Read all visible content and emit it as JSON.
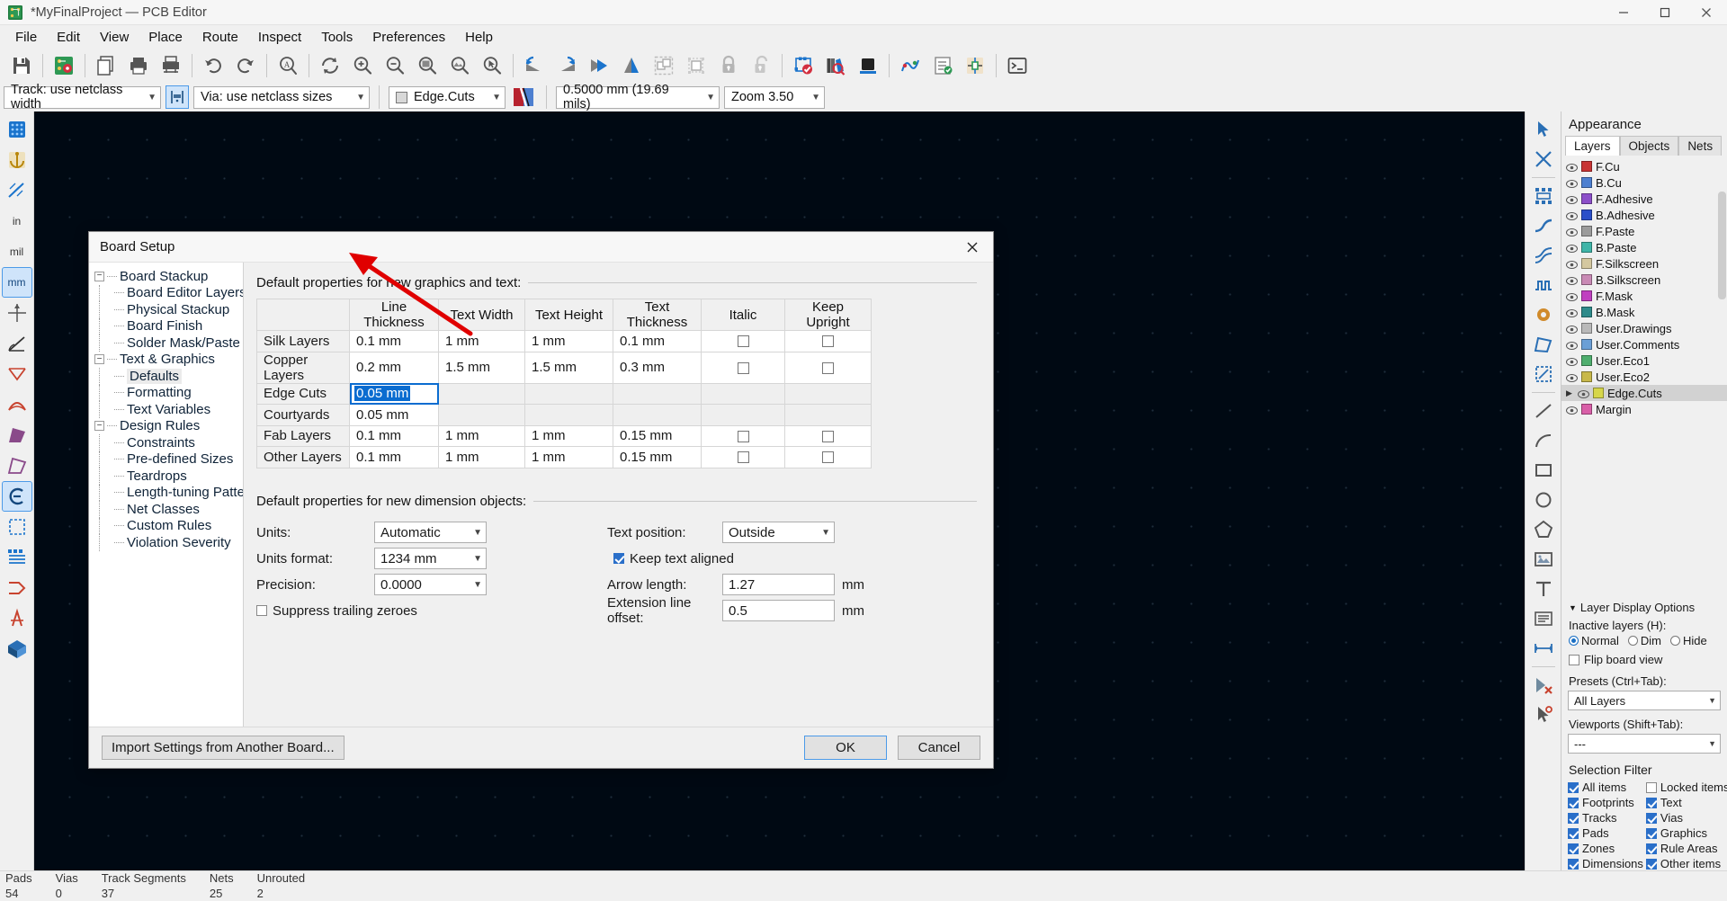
{
  "window": {
    "title": "*MyFinalProject — PCB Editor",
    "icon": "kicad-pcb-icon",
    "minimize": "—",
    "maximize": "▢",
    "close": "✕"
  },
  "menu": {
    "items": [
      "File",
      "Edit",
      "View",
      "Place",
      "Route",
      "Inspect",
      "Tools",
      "Preferences",
      "Help"
    ]
  },
  "toolbar_main": {
    "buttons": [
      {
        "name": "save-icon",
        "tip": "Save"
      },
      {
        "name": "board-setup-icon",
        "tip": "Board Setup"
      },
      {
        "name": "page-settings-icon",
        "tip": "Page Settings"
      },
      {
        "name": "print-icon",
        "tip": "Print"
      },
      {
        "name": "plot-icon",
        "tip": "Plot"
      },
      {
        "name": "undo-icon",
        "tip": "Undo"
      },
      {
        "name": "redo-icon",
        "tip": "Redo"
      },
      {
        "name": "find-icon",
        "tip": "Find"
      },
      {
        "name": "refresh-icon",
        "tip": "Refresh"
      },
      {
        "name": "zoom-in-icon",
        "tip": "Zoom In"
      },
      {
        "name": "zoom-out-icon",
        "tip": "Zoom Out"
      },
      {
        "name": "zoom-fit-page-icon",
        "tip": "Zoom to Fit Page"
      },
      {
        "name": "zoom-fit-objects-icon",
        "tip": "Zoom to Objects"
      },
      {
        "name": "zoom-selection-icon",
        "tip": "Zoom to Selection"
      },
      {
        "name": "rotate-ccw-icon",
        "tip": "Rotate Counterclockwise"
      },
      {
        "name": "rotate-cw-icon",
        "tip": "Rotate Clockwise"
      },
      {
        "name": "flip-horizontal-icon",
        "tip": "Mirror Horizontally"
      },
      {
        "name": "flip-vertical-icon",
        "tip": "Mirror Vertically"
      },
      {
        "name": "group-icon",
        "tip": "Group Items"
      },
      {
        "name": "ungroup-icon",
        "tip": "Ungroup Items"
      },
      {
        "name": "lock-icon",
        "tip": "Lock"
      },
      {
        "name": "unlock-icon",
        "tip": "Unlock"
      },
      {
        "name": "drc-icon",
        "tip": "Design Rules Checker"
      },
      {
        "name": "footprint-library-icon",
        "tip": "Footprint Library Browser"
      },
      {
        "name": "view-3d-icon",
        "tip": "3D Viewer"
      },
      {
        "name": "net-inspector-icon",
        "tip": "Net Inspector"
      },
      {
        "name": "checklist-icon",
        "tip": "Footprint Checker"
      },
      {
        "name": "schematic-icon",
        "tip": "Show Schematic Editor"
      },
      {
        "name": "scripting-console-icon",
        "tip": "Scripting Console"
      }
    ]
  },
  "toolbar_options": {
    "track_width": "Track: use netclass width",
    "netclass_toggle_icon": "auto-track-width-icon",
    "via_size": "Via: use netclass sizes",
    "active_layer": "Edge.Cuts",
    "layer_pair_icon": "layer-pair-icon",
    "grid_size": "0.5000 mm (19.69 mils)",
    "zoom_level": "Zoom 3.50"
  },
  "appearance": {
    "title": "Appearance",
    "tabs": [
      "Layers",
      "Objects",
      "Nets"
    ],
    "active_tab": "Layers",
    "layers": [
      {
        "name": "F.Cu",
        "color": "#c83434"
      },
      {
        "name": "B.Cu",
        "color": "#4d7fd0"
      },
      {
        "name": "F.Adhesive",
        "color": "#8c4fc9"
      },
      {
        "name": "B.Adhesive",
        "color": "#2b4fc9"
      },
      {
        "name": "F.Paste",
        "color": "#9b9b9b"
      },
      {
        "name": "B.Paste",
        "color": "#3fb5a8"
      },
      {
        "name": "F.Silkscreen",
        "color": "#d4c8a0"
      },
      {
        "name": "B.Silkscreen",
        "color": "#c98ab5"
      },
      {
        "name": "F.Mask",
        "color": "#c040c0"
      },
      {
        "name": "B.Mask",
        "color": "#2e8b8b"
      },
      {
        "name": "User.Drawings",
        "color": "#b9b9b9"
      },
      {
        "name": "User.Comments",
        "color": "#6b9fd6"
      },
      {
        "name": "User.Eco1",
        "color": "#4fae6e"
      },
      {
        "name": "User.Eco2",
        "color": "#c8b84a"
      },
      {
        "name": "Edge.Cuts",
        "color": "#d6d64a",
        "selected": true
      },
      {
        "name": "Margin",
        "color": "#d95fa8"
      }
    ],
    "layer_display_options": {
      "header": "Layer Display Options",
      "inactive_label": "Inactive layers (H):",
      "modes": [
        "Normal",
        "Dim",
        "Hide"
      ],
      "selected_mode": "Normal",
      "flip_board_view": "Flip board view",
      "flip_board_checked": false
    },
    "presets": {
      "label": "Presets (Ctrl+Tab):",
      "value": "All Layers"
    },
    "viewports": {
      "label": "Viewports (Shift+Tab):",
      "value": "---"
    },
    "selection_filter": {
      "title": "Selection Filter",
      "items": [
        {
          "label": "All items",
          "checked": true
        },
        {
          "label": "Locked items",
          "checked": false
        },
        {
          "label": "Footprints",
          "checked": true
        },
        {
          "label": "Text",
          "checked": true
        },
        {
          "label": "Tracks",
          "checked": true
        },
        {
          "label": "Vias",
          "checked": true
        },
        {
          "label": "Pads",
          "checked": true
        },
        {
          "label": "Graphics",
          "checked": true
        },
        {
          "label": "Zones",
          "checked": true
        },
        {
          "label": "Rule Areas",
          "checked": true
        },
        {
          "label": "Dimensions",
          "checked": true
        },
        {
          "label": "Other items",
          "checked": true
        }
      ]
    }
  },
  "left_tools": [
    {
      "name": "grid-origin-icon"
    },
    {
      "name": "anchor-icon"
    },
    {
      "name": "measure-icon"
    },
    {
      "name": "unit-inch-icon",
      "label": "in"
    },
    {
      "name": "unit-mil-icon",
      "label": "mil"
    },
    {
      "name": "unit-mm-icon",
      "label": "mm",
      "active": true
    },
    {
      "name": "cursor-full-icon"
    },
    {
      "name": "polar-coords-icon"
    },
    {
      "name": "ratsnest-icon"
    },
    {
      "name": "ratsnest-curved-icon"
    },
    {
      "name": "zone-filled-icon"
    },
    {
      "name": "zone-outline-icon"
    },
    {
      "name": "pad-sketch-icon"
    },
    {
      "name": "via-sketch-icon"
    },
    {
      "name": "track-sketch-icon"
    },
    {
      "name": "contrast-mode-icon"
    },
    {
      "name": "net-color-icon"
    },
    {
      "name": "ratsnest-display-icon"
    },
    {
      "name": "3d-view-icon"
    }
  ],
  "right_tools": [
    {
      "name": "select-cursor-icon",
      "active": true
    },
    {
      "name": "highlight-net-icon"
    },
    {
      "name": "footprint-place-icon"
    },
    {
      "name": "route-track-icon"
    },
    {
      "name": "route-diffpair-icon"
    },
    {
      "name": "tune-length-icon"
    },
    {
      "name": "add-via-icon"
    },
    {
      "name": "add-zone-icon"
    },
    {
      "name": "draw-line-icon"
    },
    {
      "name": "draw-arc-icon"
    },
    {
      "name": "draw-rectangle-icon"
    },
    {
      "name": "draw-circle-icon"
    },
    {
      "name": "draw-polygon-icon"
    },
    {
      "name": "add-image-icon"
    },
    {
      "name": "add-text-icon"
    },
    {
      "name": "add-textbox-icon"
    },
    {
      "name": "add-dimension-icon"
    },
    {
      "name": "delete-icon"
    },
    {
      "name": "set-origin-icon"
    }
  ],
  "dialog": {
    "title": "Board Setup",
    "close_icon": "close-icon",
    "tree": [
      {
        "label": "Board Stackup",
        "level": 0,
        "expander": "−"
      },
      {
        "label": "Board Editor Layers",
        "level": 1
      },
      {
        "label": "Physical Stackup",
        "level": 1
      },
      {
        "label": "Board Finish",
        "level": 1
      },
      {
        "label": "Solder Mask/Paste",
        "level": 1
      },
      {
        "label": "Text & Graphics",
        "level": 0,
        "expander": "−"
      },
      {
        "label": "Defaults",
        "level": 1,
        "selected": true
      },
      {
        "label": "Formatting",
        "level": 1
      },
      {
        "label": "Text Variables",
        "level": 1
      },
      {
        "label": "Design Rules",
        "level": 0,
        "expander": "−"
      },
      {
        "label": "Constraints",
        "level": 1
      },
      {
        "label": "Pre-defined Sizes",
        "level": 1
      },
      {
        "label": "Teardrops",
        "level": 1
      },
      {
        "label": "Length-tuning Patterns",
        "level": 1
      },
      {
        "label": "Net Classes",
        "level": 1
      },
      {
        "label": "Custom Rules",
        "level": 1
      },
      {
        "label": "Violation Severity",
        "level": 1
      }
    ],
    "graphics_section": {
      "heading": "Default properties for new graphics and text:",
      "columns": [
        "",
        "Line Thickness",
        "Text Width",
        "Text Height",
        "Text Thickness",
        "Italic",
        "Keep Upright"
      ],
      "rows": [
        {
          "label": "Silk Layers",
          "line": "0.1 mm",
          "tw": "1 mm",
          "th": "1 mm",
          "tt": "0.1 mm",
          "italic": false,
          "upright": false,
          "has_text": true
        },
        {
          "label": "Copper Layers",
          "line": "0.2 mm",
          "tw": "1.5 mm",
          "th": "1.5 mm",
          "tt": "0.3 mm",
          "italic": false,
          "upright": false,
          "has_text": true
        },
        {
          "label": "Edge Cuts",
          "line": "0.05 mm",
          "tw": "",
          "th": "",
          "tt": "",
          "has_text": false,
          "editing": true,
          "selected_text": "0.05 mm"
        },
        {
          "label": "Courtyards",
          "line": "0.05 mm",
          "tw": "",
          "th": "",
          "tt": "",
          "has_text": false
        },
        {
          "label": "Fab Layers",
          "line": "0.1 mm",
          "tw": "1 mm",
          "th": "1 mm",
          "tt": "0.15 mm",
          "italic": false,
          "upright": false,
          "has_text": true
        },
        {
          "label": "Other Layers",
          "line": "0.1 mm",
          "tw": "1 mm",
          "th": "1 mm",
          "tt": "0.15 mm",
          "italic": false,
          "upright": false,
          "has_text": true
        }
      ]
    },
    "dimension_section": {
      "heading": "Default properties for new dimension objects:",
      "units_label": "Units:",
      "units_value": "Automatic",
      "units_format_label": "Units format:",
      "units_format_value": "1234 mm",
      "precision_label": "Precision:",
      "precision_value": "0.0000",
      "suppress_label": "Suppress trailing zeroes",
      "suppress_checked": false,
      "text_position_label": "Text position:",
      "text_position_value": "Outside",
      "keep_text_aligned_label": "Keep text aligned",
      "keep_text_aligned_checked": true,
      "arrow_length_label": "Arrow length:",
      "arrow_length_value": "1.27",
      "arrow_length_unit": "mm",
      "ext_offset_label": "Extension line offset:",
      "ext_offset_value": "0.5",
      "ext_offset_unit": "mm"
    },
    "footer": {
      "import_label": "Import Settings from Another Board...",
      "ok_label": "OK",
      "cancel_label": "Cancel"
    }
  },
  "annotation": {
    "arrow_color": "#e00000"
  },
  "statusbar": {
    "stats": [
      {
        "label": "Pads",
        "value": "54"
      },
      {
        "label": "Vias",
        "value": "0"
      },
      {
        "label": "Track Segments",
        "value": "37"
      },
      {
        "label": "Nets",
        "value": "25"
      },
      {
        "label": "Unrouted",
        "value": "2"
      }
    ]
  }
}
